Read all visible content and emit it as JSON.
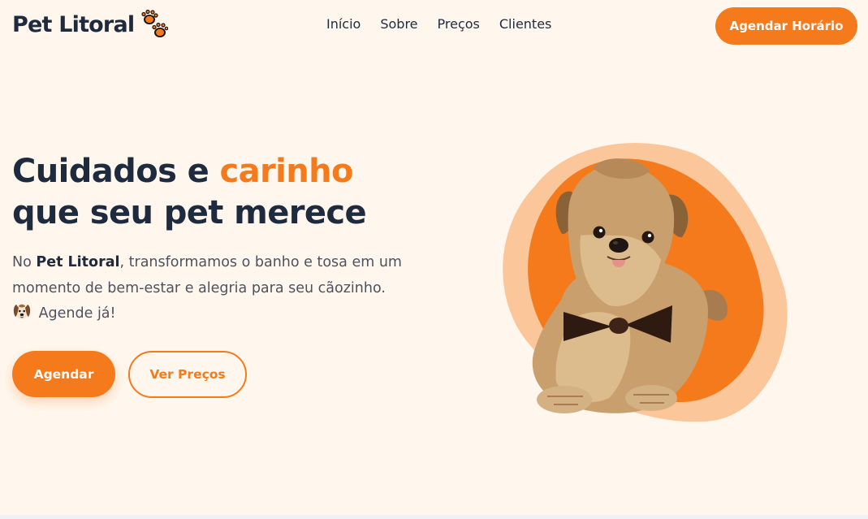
{
  "brand": {
    "name": "Pet Litoral",
    "accent_color": "#f57a1c",
    "logo_icon": "paw-prints-icon"
  },
  "nav": {
    "items": [
      {
        "label": "Início"
      },
      {
        "label": "Sobre"
      },
      {
        "label": "Preços"
      },
      {
        "label": "Clientes"
      }
    ]
  },
  "header": {
    "cta_label": "Agendar Horário"
  },
  "hero": {
    "title_part1": "Cuidados e ",
    "title_accent": "carinho",
    "title_part2": "que seu pet merece",
    "desc_prefix": "No ",
    "desc_brand": "Pet Litoral",
    "desc_body": ", transformamos o banho e tosa em um momento de bem-estar e alegria para seu cãozinho.",
    "desc_emoji_icon": "dog-face-emoji-icon",
    "desc_cta": " Agende já!",
    "primary_button": "Agendar",
    "secondary_button": "Ver Preços",
    "image_icon": "yorkshire-dog-photo"
  },
  "colors": {
    "background": "#fff7ee",
    "text_dark": "#1e2a3d",
    "blob_light": "#fbc69a",
    "blob_dark": "#f57a1c"
  }
}
